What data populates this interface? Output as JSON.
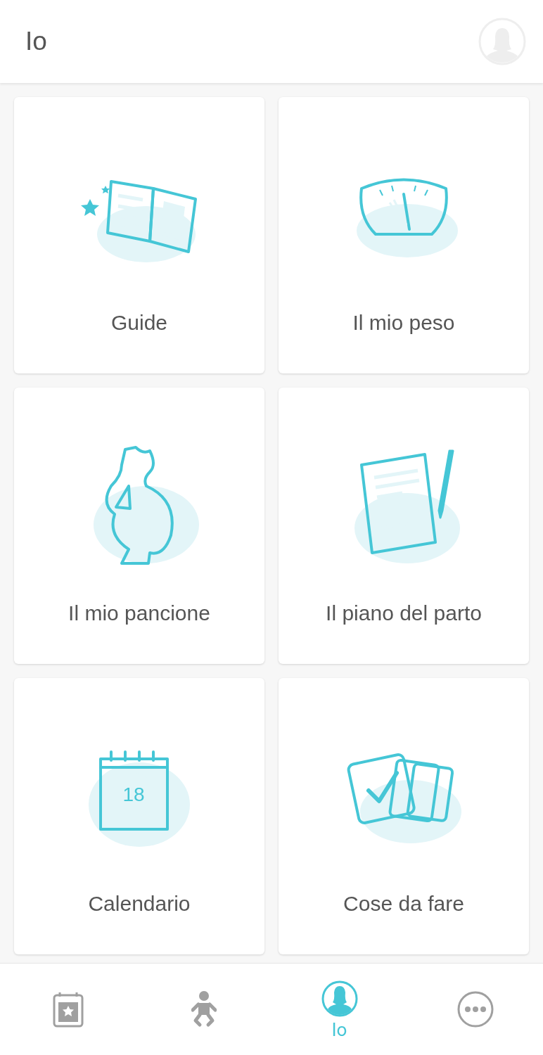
{
  "header": {
    "title": "Io"
  },
  "tiles": [
    {
      "kind": "guide",
      "label": "Guide"
    },
    {
      "kind": "weight",
      "label": "Il mio peso"
    },
    {
      "kind": "belly",
      "label": "Il mio pancione"
    },
    {
      "kind": "plan",
      "label": "Il piano del parto"
    },
    {
      "kind": "calendar",
      "label": "Calendario",
      "badge": "18"
    },
    {
      "kind": "todo",
      "label": "Cose da fare"
    }
  ],
  "nav": [
    {
      "kind": "calendar",
      "selected": false
    },
    {
      "kind": "baby",
      "selected": false
    },
    {
      "kind": "me",
      "selected": true,
      "label": "Io"
    },
    {
      "kind": "more",
      "selected": false
    }
  ]
}
